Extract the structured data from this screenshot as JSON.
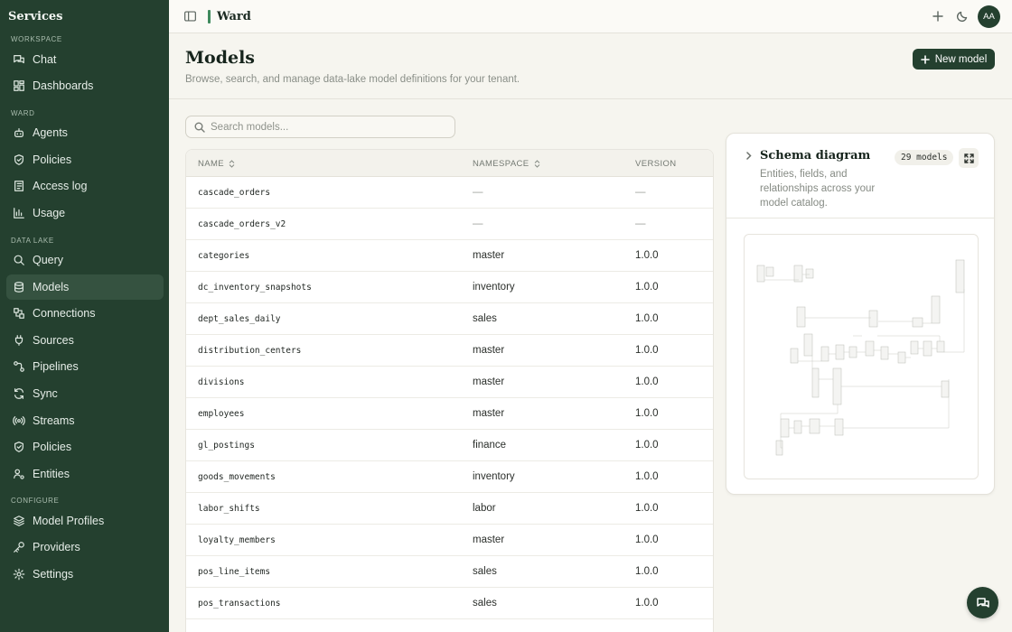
{
  "sidebar": {
    "title": "Services",
    "sections": {
      "workspace": "WORKSPACE",
      "ward": "WARD",
      "data_lake": "DATA LAKE",
      "configure": "CONFIGURE"
    },
    "items": [
      {
        "label": "Chat",
        "icon": "chat-icon"
      },
      {
        "label": "Dashboards",
        "icon": "dashboard-icon"
      },
      {
        "label": "Agents",
        "icon": "bot-icon"
      },
      {
        "label": "Policies",
        "icon": "shield-icon"
      },
      {
        "label": "Access log",
        "icon": "log-icon"
      },
      {
        "label": "Usage",
        "icon": "bar-chart-icon"
      },
      {
        "label": "Query",
        "icon": "search-icon"
      },
      {
        "label": "Models",
        "icon": "database-icon",
        "active": true
      },
      {
        "label": "Connections",
        "icon": "connections-icon"
      },
      {
        "label": "Sources",
        "icon": "plug-icon"
      },
      {
        "label": "Pipelines",
        "icon": "pipeline-icon"
      },
      {
        "label": "Sync",
        "icon": "sync-icon"
      },
      {
        "label": "Streams",
        "icon": "radio-icon"
      },
      {
        "label": "Policies",
        "icon": "shield-icon"
      },
      {
        "label": "Entities",
        "icon": "user-cog-icon"
      },
      {
        "label": "Model Profiles",
        "icon": "layers-icon"
      },
      {
        "label": "Providers",
        "icon": "key-icon"
      },
      {
        "label": "Settings",
        "icon": "gear-icon"
      }
    ]
  },
  "topbar": {
    "app_name": "Ward",
    "avatar_initials": "AA"
  },
  "header": {
    "title": "Models",
    "subtitle": "Browse, search, and manage data-lake model definitions for your tenant.",
    "new_button": "New model"
  },
  "search": {
    "placeholder": "Search models..."
  },
  "table": {
    "columns": {
      "name": "NAME",
      "namespace": "NAMESPACE",
      "version": "VERSION"
    },
    "rows": [
      {
        "name": "cascade_orders",
        "namespace": "—",
        "version": "—"
      },
      {
        "name": "cascade_orders_v2",
        "namespace": "—",
        "version": "—"
      },
      {
        "name": "categories",
        "namespace": "master",
        "version": "1.0.0"
      },
      {
        "name": "dc_inventory_snapshots",
        "namespace": "inventory",
        "version": "1.0.0"
      },
      {
        "name": "dept_sales_daily",
        "namespace": "sales",
        "version": "1.0.0"
      },
      {
        "name": "distribution_centers",
        "namespace": "master",
        "version": "1.0.0"
      },
      {
        "name": "divisions",
        "namespace": "master",
        "version": "1.0.0"
      },
      {
        "name": "employees",
        "namespace": "master",
        "version": "1.0.0"
      },
      {
        "name": "gl_postings",
        "namespace": "finance",
        "version": "1.0.0"
      },
      {
        "name": "goods_movements",
        "namespace": "inventory",
        "version": "1.0.0"
      },
      {
        "name": "labor_shifts",
        "namespace": "labor",
        "version": "1.0.0"
      },
      {
        "name": "loyalty_members",
        "namespace": "master",
        "version": "1.0.0"
      },
      {
        "name": "pos_line_items",
        "namespace": "sales",
        "version": "1.0.0"
      },
      {
        "name": "pos_transactions",
        "namespace": "sales",
        "version": "1.0.0"
      }
    ]
  },
  "schema": {
    "title": "Schema diagram",
    "description": "Entities, fields, and relationships across your model catalog.",
    "badge": "29 models"
  }
}
